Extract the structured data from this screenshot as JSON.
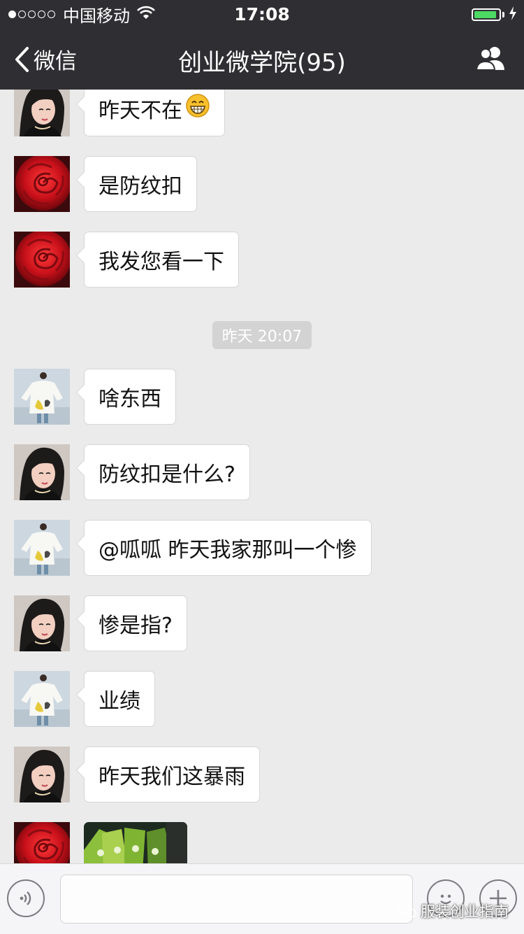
{
  "status_bar": {
    "carrier": "中国移动",
    "time": "17:08",
    "signal_filled": 1,
    "signal_total": 5,
    "battery_level": 0.9
  },
  "nav": {
    "back_label": "微信",
    "title": "创业微学院(95)"
  },
  "timestamp": "昨天 20:07",
  "messages": [
    {
      "sender_avatar": "woman-portrait",
      "text": "昨天不在",
      "emoji": "grinning-emoji"
    },
    {
      "sender_avatar": "red-rose",
      "text": "是防纹扣"
    },
    {
      "sender_avatar": "red-rose",
      "text": "我发您看一下"
    },
    {
      "sender_avatar": "fashion-model",
      "text": "啥东西"
    },
    {
      "sender_avatar": "woman-portrait",
      "text": "防纹扣是什么?"
    },
    {
      "sender_avatar": "fashion-model",
      "text": "@呱呱 昨天我家那叫一个惨"
    },
    {
      "sender_avatar": "woman-portrait",
      "text": "惨是指?"
    },
    {
      "sender_avatar": "fashion-model",
      "text": "业绩"
    },
    {
      "sender_avatar": "woman-portrait",
      "text": "昨天我们这暴雨"
    },
    {
      "sender_avatar": "red-rose",
      "image": "green-packages-photo"
    }
  ],
  "watermark": "服装创业指南",
  "colors": {
    "header": "#2f2f33",
    "chat_bg": "#ebebeb",
    "bubble": "#ffffff",
    "battery": "#4cd964"
  }
}
